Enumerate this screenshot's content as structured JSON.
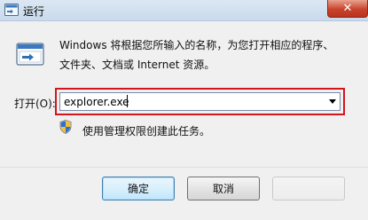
{
  "window": {
    "title": "运行",
    "close_symbol": "✕",
    "title_icon": "run-icon",
    "close_color": "#c8442c"
  },
  "description": {
    "line1": "Windows 将根据您所输入的名称，为您打开相应的程序、",
    "line2": "文件夹、文档或 Internet 资源。"
  },
  "open_field": {
    "label": "打开(O):",
    "value": "explorer.exe",
    "highlight_color": "#d2151c"
  },
  "admin_note": {
    "icon": "uac-shield-icon",
    "text": "使用管理权限创建此任务。"
  },
  "buttons": {
    "ok": "确定",
    "cancel": "取消",
    "browse": ""
  }
}
